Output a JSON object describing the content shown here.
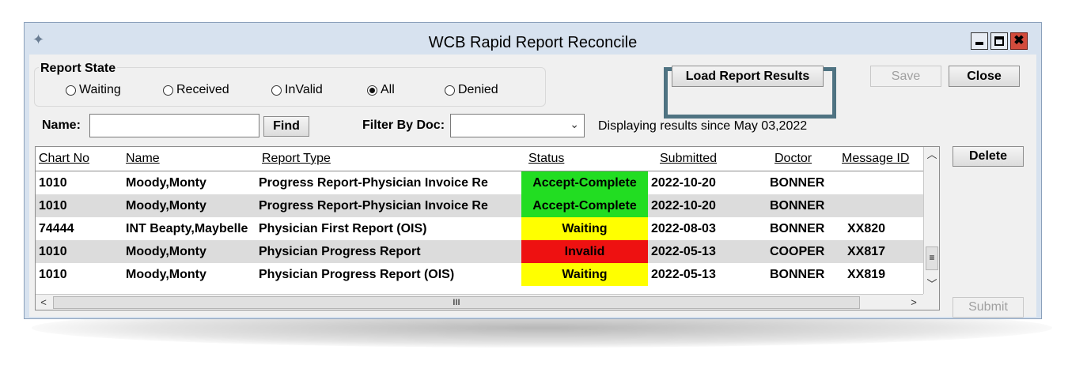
{
  "window": {
    "title": "WCB Rapid Report Reconcile",
    "icon": "feather-icon",
    "controls": {
      "minimize": "minimize-icon",
      "maximize": "maximize-icon",
      "close": "✖"
    }
  },
  "report_state": {
    "label": "Report State",
    "options": [
      "Waiting",
      "Received",
      "InValid",
      "All",
      "Denied"
    ],
    "selected": "All"
  },
  "buttons": {
    "load": "Load Report Results",
    "save": "Save",
    "close": "Close",
    "delete": "Delete",
    "submit": "Submit",
    "find": "Find"
  },
  "filters": {
    "name_label": "Name:",
    "name_value": "",
    "doc_label": "Filter By Doc:",
    "doc_value": "",
    "info": "Displaying results since May 03,2022"
  },
  "table": {
    "columns": [
      "Chart No",
      "Name",
      "Report Type",
      "Status",
      "Submitted",
      "Doctor",
      "Message ID"
    ],
    "rows": [
      {
        "chart": "1010",
        "name": "Moody,Monty",
        "type": "Progress Report-Physician Invoice Re",
        "status": "Accept-Complete",
        "submitted": "2022-10-20",
        "doctor": "BONNER",
        "msg": ""
      },
      {
        "chart": "1010",
        "name": "Moody,Monty",
        "type": "Progress Report-Physician Invoice Re",
        "status": "Accept-Complete",
        "submitted": "2022-10-20",
        "doctor": "BONNER",
        "msg": ""
      },
      {
        "chart": "74444",
        "name": "INT Beapty,Maybelle",
        "type": "Physician First Report (OIS)",
        "status": "Waiting",
        "submitted": "2022-08-03",
        "doctor": "BONNER",
        "msg": "XX820"
      },
      {
        "chart": "1010",
        "name": "Moody,Monty",
        "type": "Physician Progress Report",
        "status": "Invalid",
        "submitted": "2022-05-13",
        "doctor": "COOPER",
        "msg": "XX817"
      },
      {
        "chart": "1010",
        "name": "Moody,Monty",
        "type": "Physician Progress Report (OIS)",
        "status": "Waiting",
        "submitted": "2022-05-13",
        "doctor": "BONNER",
        "msg": "XX819"
      }
    ]
  },
  "scrollbar": {
    "up": "︿",
    "down": "﹀",
    "left": "<",
    "right": ">",
    "grip_v": "≡",
    "grip_h": "III"
  },
  "colors": {
    "accept": "#22dd22",
    "waiting": "#ffff00",
    "invalid": "#ee1111",
    "highlight_border": "#4f7382"
  }
}
